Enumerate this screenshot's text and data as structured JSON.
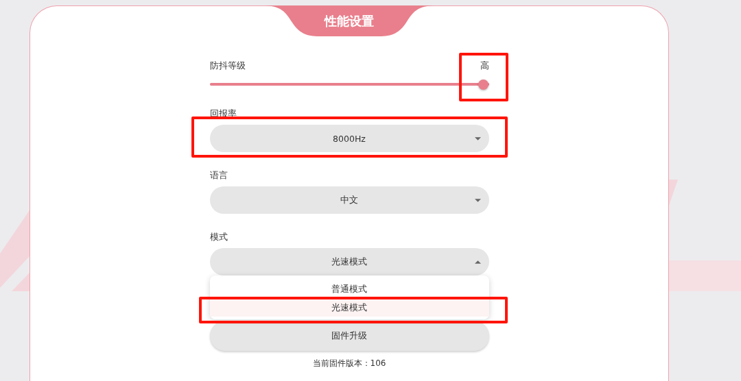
{
  "panel": {
    "title": "性能设置"
  },
  "slider": {
    "label": "防抖等级",
    "value_text": "高",
    "level": 1,
    "annotated": true
  },
  "dropdowns": [
    {
      "label": "回报率",
      "value": "8000Hz",
      "expanded": false,
      "annotated": true
    },
    {
      "label": "语言",
      "value": "中文",
      "expanded": false
    },
    {
      "label": "模式",
      "value": "光速模式",
      "expanded": true,
      "options": [
        {
          "label": "普通模式",
          "selected": false
        },
        {
          "label": "光速模式",
          "selected": true,
          "annotated": true
        }
      ]
    }
  ],
  "firmware_button": "固件升级",
  "version_text": "当前固件版本：106"
}
